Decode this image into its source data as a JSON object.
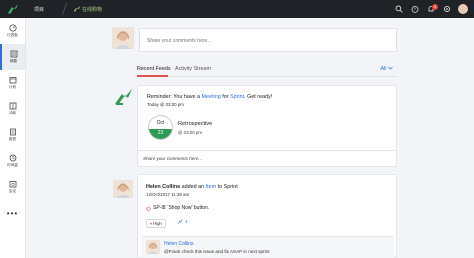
{
  "topbar": {
    "project_label": "项目",
    "board_label": "在线购物",
    "notification_count": "3"
  },
  "sidebar": {
    "items": [
      {
        "label": "仪表板",
        "icon": "dashboard-icon"
      },
      {
        "label": "摘要",
        "icon": "feed-icon"
      },
      {
        "label": "计划",
        "icon": "plan-icon"
      },
      {
        "label": "冲刺",
        "icon": "sprint-icon"
      },
      {
        "label": "报表",
        "icon": "reports-icon"
      },
      {
        "label": "时间量",
        "icon": "time-icon"
      },
      {
        "label": "会议",
        "icon": "meeting-icon"
      }
    ],
    "more": "•••"
  },
  "composer": {
    "placeholder": "Share your comments here..."
  },
  "tabs": {
    "recent": "Recent Feeds",
    "activity": "Activity Stream",
    "filter": "All"
  },
  "reminder": {
    "prefix": "Reminder: You have a ",
    "meeting": "Meeting",
    "for": " for ",
    "sprint": "Sprint",
    "suffix": ". Get ready!",
    "time": "Today @ 03:00 pm",
    "date_month": "Oct",
    "date_day": "23",
    "event_name": "Retrospective",
    "event_time": "@ 03:00 pm",
    "comment_placeholder": "Share your comments here..."
  },
  "activity": {
    "person": "Helen Collins",
    "added": " added an ",
    "item": "Item",
    "to_sprint": " to Sprint",
    "time": "12/Oct/2017 11:38 am",
    "item_id": "SP-I8",
    "item_title": "'Shop Now' button.",
    "priority": "High",
    "points": "1",
    "nested_name": "Helen Collins",
    "nested_text": "@Frank check this issue and fix ASAP in next sprint"
  },
  "colors": {
    "accent_green": "#2e9a55",
    "link_blue": "#2f6fd6",
    "badge_red": "#e5453b",
    "topbar": "#1f2226"
  }
}
